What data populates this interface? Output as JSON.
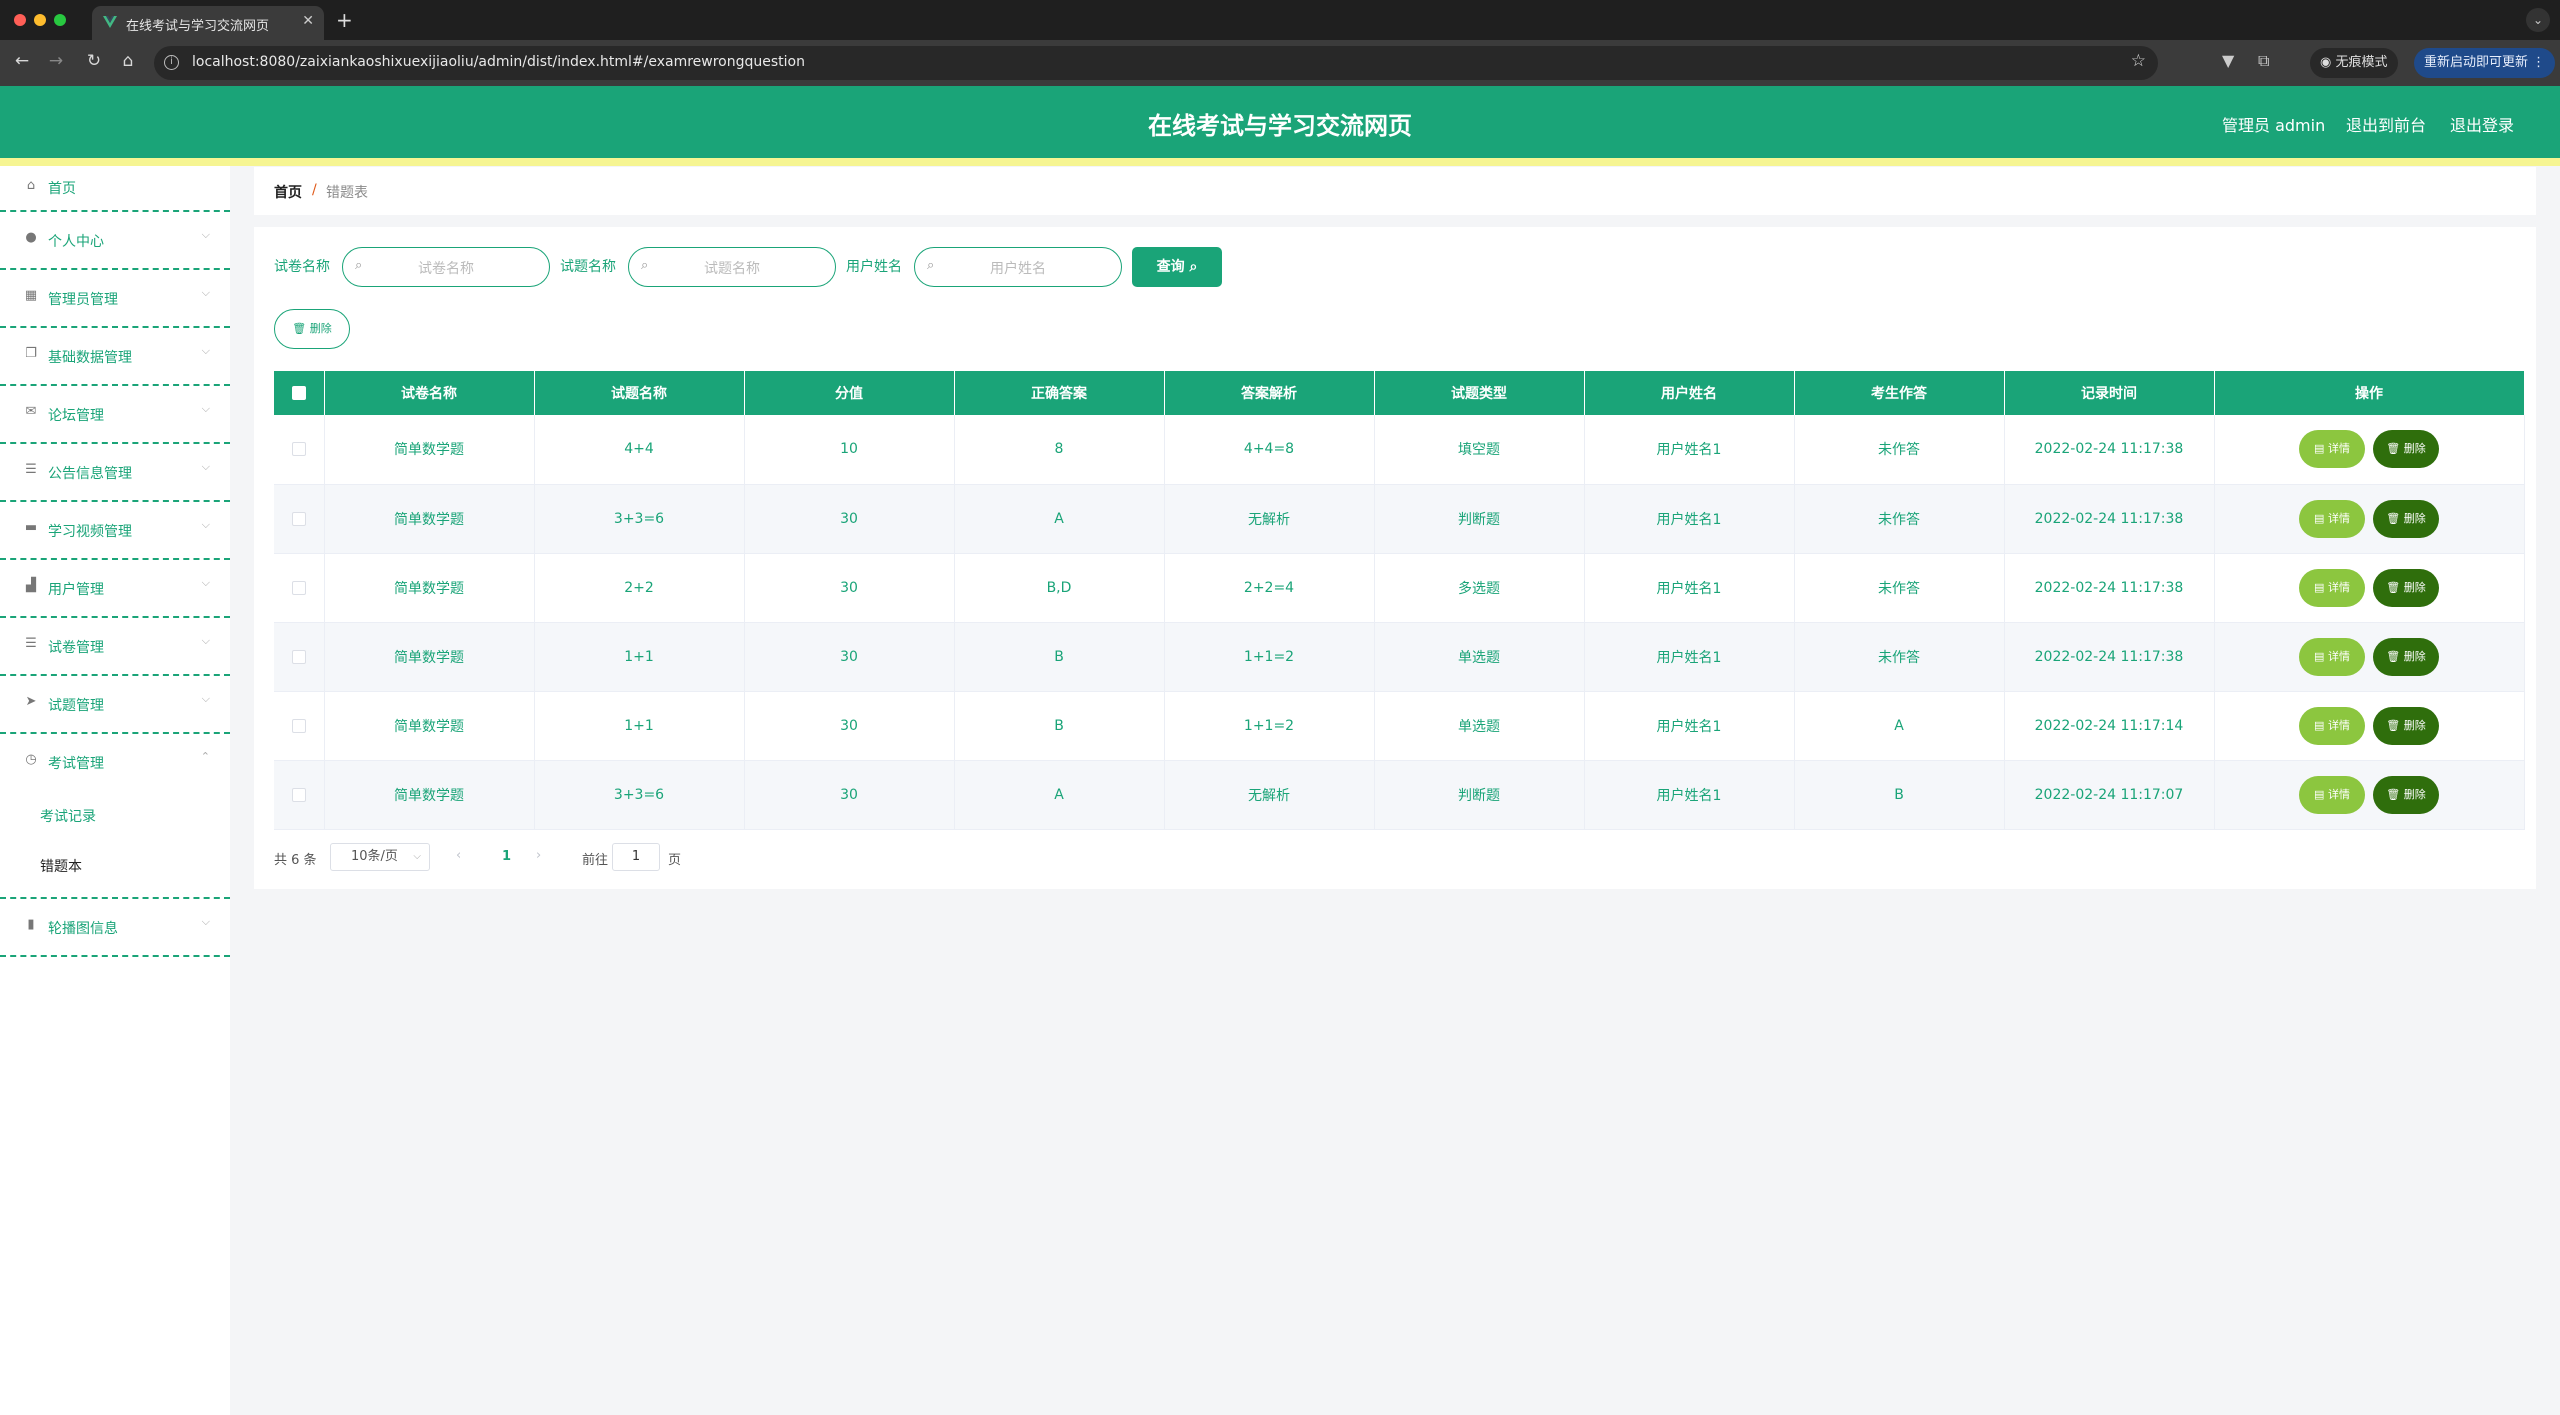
{
  "browser": {
    "tab_title": "在线考试与学习交流网页",
    "url": "localhost:8080/zaixiankaoshixuexijiaoliu/admin/dist/index.html#/examrewrongquestion",
    "incognito_label": "无痕模式",
    "update_label": "重新启动即可更新"
  },
  "header": {
    "title": "在线考试与学习交流网页",
    "user_label": "管理员 admin",
    "front_link": "退出到前台",
    "logout_link": "退出登录"
  },
  "sidebar": {
    "items": [
      {
        "label": "首页",
        "icon": "home-icon"
      },
      {
        "label": "个人中心",
        "icon": "user-icon"
      },
      {
        "label": "管理员管理",
        "icon": "grid-icon"
      },
      {
        "label": "基础数据管理",
        "icon": "copy-icon"
      },
      {
        "label": "论坛管理",
        "icon": "mail-icon"
      },
      {
        "label": "公告信息管理",
        "icon": "list-icon"
      },
      {
        "label": "学习视频管理",
        "icon": "monitor-icon"
      },
      {
        "label": "用户管理",
        "icon": "thumb-icon"
      },
      {
        "label": "试卷管理",
        "icon": "list-icon"
      },
      {
        "label": "试题管理",
        "icon": "send-icon"
      },
      {
        "label": "考试管理",
        "icon": "clock-icon"
      },
      {
        "label": "轮播图信息",
        "icon": "chart-icon"
      }
    ],
    "exam_sub": {
      "record": "考试记录",
      "wrongbook": "错题本"
    }
  },
  "breadcrumb": {
    "home": "首页",
    "sep": "/",
    "current": "错题表"
  },
  "filters": {
    "paper": {
      "label": "试卷名称",
      "placeholder": "试卷名称"
    },
    "question": {
      "label": "试题名称",
      "placeholder": "试题名称"
    },
    "user": {
      "label": "用户姓名",
      "placeholder": "用户姓名"
    },
    "query_button": "查询",
    "delete_button": "删除"
  },
  "table": {
    "columns": [
      "试卷名称",
      "试题名称",
      "分值",
      "正确答案",
      "答案解析",
      "试题类型",
      "用户姓名",
      "考生作答",
      "记录时间",
      "操作"
    ],
    "detail_label": "详情",
    "delete_label": "删除",
    "rows": [
      [
        "简单数学题",
        "4+4",
        "10",
        "8",
        "4+4=8",
        "填空题",
        "用户姓名1",
        "未作答",
        "2022-02-24 11:17:38"
      ],
      [
        "简单数学题",
        "3+3=6",
        "30",
        "A",
        "无解析",
        "判断题",
        "用户姓名1",
        "未作答",
        "2022-02-24 11:17:38"
      ],
      [
        "简单数学题",
        "2+2",
        "30",
        "B,D",
        "2+2=4",
        "多选题",
        "用户姓名1",
        "未作答",
        "2022-02-24 11:17:38"
      ],
      [
        "简单数学题",
        "1+1",
        "30",
        "B",
        "1+1=2",
        "单选题",
        "用户姓名1",
        "未作答",
        "2022-02-24 11:17:38"
      ],
      [
        "简单数学题",
        "1+1",
        "30",
        "B",
        "1+1=2",
        "单选题",
        "用户姓名1",
        "A",
        "2022-02-24 11:17:14"
      ],
      [
        "简单数学题",
        "3+3=6",
        "30",
        "A",
        "无解析",
        "判断题",
        "用户姓名1",
        "B",
        "2022-02-24 11:17:07"
      ]
    ]
  },
  "pagination": {
    "total": "共 6 条",
    "page_size": "10条/页",
    "current": "1",
    "goto_label": "前往",
    "goto_value": "1",
    "page_suffix": "页"
  },
  "colors": {
    "primary": "#1aa478",
    "accent_stripe": "#f6f592",
    "detail_btn": "#8cc63f",
    "delete_btn": "#2f6e0c"
  }
}
